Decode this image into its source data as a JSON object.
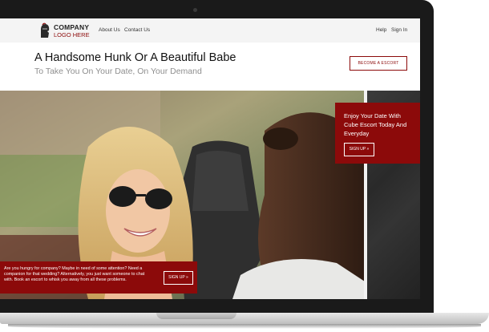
{
  "navbar": {
    "logo_line1": "COMPANY",
    "logo_line2": "LOGO HERE",
    "links": [
      "About Us",
      "Contact Us"
    ],
    "right_links": [
      "Help",
      "Sign In"
    ]
  },
  "hero": {
    "headline": "A Handsome Hunk Or A Beautiful Babe",
    "subheadline": "To Take You On Your Date, On Your Demand",
    "cta_label": "BECOME A ESCORT"
  },
  "promo": {
    "text": "Enjoy Your Date With Cube Escort Today And Everyday",
    "button_label": "SIGN UP »"
  },
  "info": {
    "text": "Are you hungry for company? Maybe in need of some attention? Need a companion for that wedding? Alternatively, you just want someone to chat with. Book an escort to whisk you away from all these problems.",
    "button_label": "SIGN UP »"
  },
  "colors": {
    "accent": "#8c0a0a",
    "navbar_bg": "#f4f4f4",
    "laptop_bezel": "#1a1a1a"
  },
  "icons": {
    "logo": "knight-helmet-icon",
    "camera": "webcam-icon"
  }
}
